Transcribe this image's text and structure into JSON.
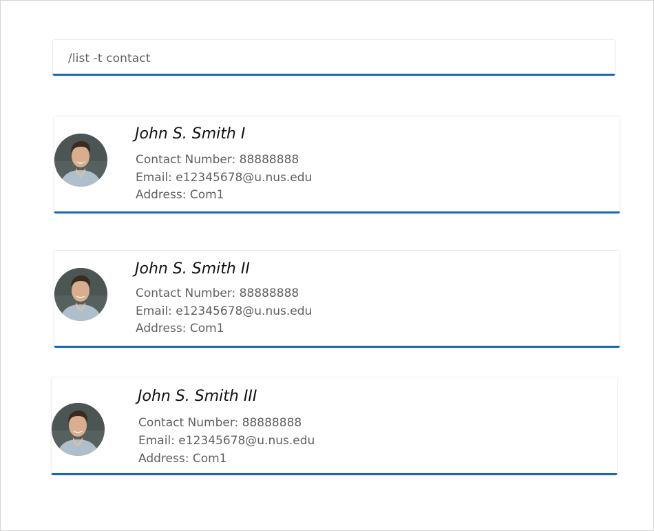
{
  "command": {
    "value": "/list -t contact"
  },
  "contacts": [
    {
      "name": "John S. Smith I",
      "contact_number": "Contact Number: 88888888",
      "email": "Email: e12345678@u.nus.edu",
      "address": "Address: Com1",
      "avatar_icon": "person-photo"
    },
    {
      "name": "John S. Smith II",
      "contact_number": "Contact Number: 88888888",
      "email": "Email: e12345678@u.nus.edu",
      "address": "Address: Com1",
      "avatar_icon": "person-photo"
    },
    {
      "name": "John S. Smith III",
      "contact_number": "Contact Number: 88888888",
      "email": "Email: e12345678@u.nus.edu",
      "address": "Address: Com1",
      "avatar_icon": "person-photo"
    }
  ],
  "colors": {
    "accent": "#1a66b3",
    "text_primary": "#111111",
    "text_secondary": "#5f5f5f",
    "card_border": "#ececec"
  }
}
